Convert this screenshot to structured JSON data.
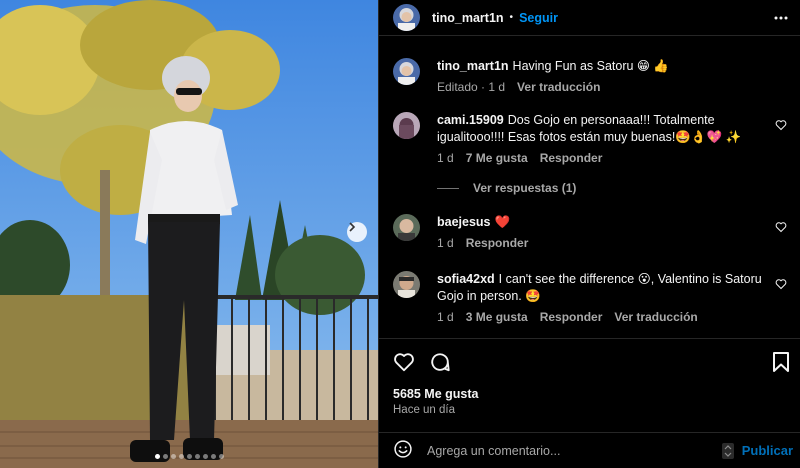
{
  "post": {
    "author": "tino_mart1n",
    "separator": "•",
    "follow_label": "Seguir",
    "caption": "Having Fun as Satoru 😁 👍",
    "caption_meta": {
      "edited": "Editado · 1 d",
      "translate": "Ver traducción"
    },
    "photo_alt": "Cosplayer as Satoru Gojo standing outdoors",
    "carousel": {
      "total": 9,
      "active": 1
    }
  },
  "comments": [
    {
      "user": "cami.15909",
      "text": "Dos Gojo en personaaa!!! Totalmente igualitooo!!!! Esas fotos están muy buenas!🤩👌💖 ✨",
      "time": "1 d",
      "likes": "7 Me gusta",
      "reply": "Responder",
      "view_replies": "Ver respuestas (1)"
    },
    {
      "user": "baejesus",
      "text": "❤️",
      "time": "1 d",
      "reply": "Responder"
    },
    {
      "user": "sofia42xd",
      "text": "I can't see the difference 😮, Valentino is Satoru Gojo in person. 🤩",
      "time": "1 d",
      "likes": "3 Me gusta",
      "reply": "Responder",
      "translate": "Ver traducción"
    }
  ],
  "stats": {
    "likes": "5685 Me gusta",
    "time_ago": "Hace un día"
  },
  "composer": {
    "placeholder": "Agrega un comentario...",
    "publish_label": "Publicar"
  },
  "colors": {
    "accent": "#0095f6",
    "background": "#000000",
    "secondary_text": "#a8a8a8",
    "heart": "#ff3040"
  }
}
